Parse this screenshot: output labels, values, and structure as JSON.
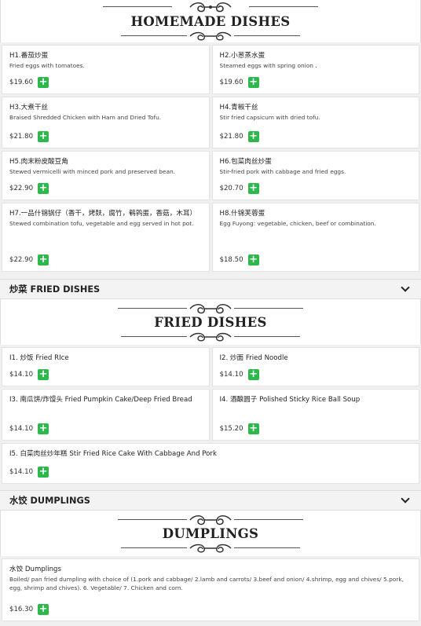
{
  "homemade": {
    "banner_title": "HOMEMADE DISHES",
    "items": [
      {
        "name": "H1.番茄炒蛋",
        "desc": "Fried eggs with tomatoes.",
        "price": "$19.60"
      },
      {
        "name": "H2.小葱蒸水蛋",
        "desc": "Steamed eggs with spring onion .",
        "price": "$19.60"
      },
      {
        "name": "H3.大煮干丝",
        "desc": "Braised Shredded Chicken with Ham and Dried Tofu.",
        "price": "$21.80"
      },
      {
        "name": "H4.青椒干丝",
        "desc": "Stir fried capsicum with dried tofu.",
        "price": "$21.80"
      },
      {
        "name": "H5.肉末粉皮酸豆角",
        "desc": "Stewed vermicelli with minced pork and preserved bean.",
        "price": "$22.90"
      },
      {
        "name": "H6.包菜肉丝炒蛋",
        "desc": "Stir-fried pork with cabbage and fried eggs.",
        "price": "$20.70"
      },
      {
        "name": "H7.一品什锦锅仔（香干，烤麸，腐竹，鹌鹑蛋，香菇，木耳）",
        "desc": "Stewed combination tofu, vegetable and egg served in hot pot.",
        "price": "$22.90"
      },
      {
        "name": "H8.什锦芙蓉蛋",
        "desc": "Egg Fuyong: vegetable, chicken, beef or combination.",
        "price": "$18.50"
      }
    ]
  },
  "fried": {
    "header_label": "炒菜 FRIED DISHES",
    "banner_title": "FRIED DISHES",
    "items": [
      {
        "name": "I1. 炒饭 Fried RIce",
        "price": "$14.10"
      },
      {
        "name": "I2. 炒面 Fried Noodle",
        "price": "$14.10"
      },
      {
        "name": "I3. 南瓜饼/炸馒头 Fried Pumpkin Cake/Deep Fried Bread",
        "price": "$14.10"
      },
      {
        "name": "I4. 酒酿圆子 Polished Sticky Rice Ball Soup",
        "price": "$15.20"
      },
      {
        "name": "I5. 白菜肉丝炒年糕 Stir Fried Rice Cake With Cabbage And Pork",
        "price": "$14.10"
      }
    ]
  },
  "dumplings": {
    "header_label": "水饺 DUMPLINGS",
    "banner_title": "DUMPLINGS",
    "items": [
      {
        "name": "水饺 Dumplings",
        "desc": "Boiled/ pan fried dumpling with choice of (1.pork and cabbage/ 2.lamb and carrots/ 3.beef and onion/ 4.shrimp, egg and chives/ 5.pork, egg, shrimp and chives). 6. Vegetable/ 7. Chicken and corn.",
        "price": "$16.30"
      }
    ]
  },
  "icons": {
    "add": "plus-icon",
    "collapse": "chevron-down-icon",
    "ornament": "scroll-ornament-icon"
  },
  "colors": {
    "add_button": "#2db84d",
    "header_bg": "#f3f3f3",
    "card_bg": "#ffffff"
  }
}
